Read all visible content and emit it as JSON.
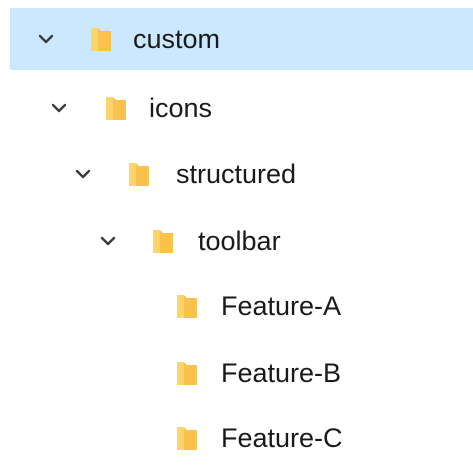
{
  "tree": {
    "nodes": [
      {
        "label": "custom",
        "expanded": true,
        "selected": true,
        "icon": "folder-icon"
      },
      {
        "label": "icons",
        "expanded": true,
        "selected": false,
        "icon": "folder-icon"
      },
      {
        "label": "structured",
        "expanded": true,
        "selected": false,
        "icon": "folder-icon"
      },
      {
        "label": "toolbar",
        "expanded": true,
        "selected": false,
        "icon": "folder-icon"
      },
      {
        "label": "Feature-A",
        "expanded": false,
        "selected": false,
        "icon": "folder-icon"
      },
      {
        "label": "Feature-B",
        "expanded": false,
        "selected": false,
        "icon": "folder-icon"
      },
      {
        "label": "Feature-C",
        "expanded": false,
        "selected": false,
        "icon": "folder-icon"
      }
    ]
  },
  "colors": {
    "selection": "#cce8ff",
    "folder": "#f8c24c",
    "folder_light": "#fbd56c",
    "chevron": "#3c3c3c"
  }
}
